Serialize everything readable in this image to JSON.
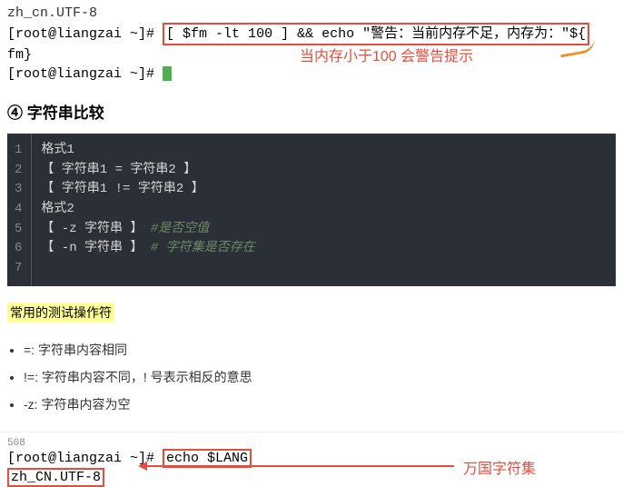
{
  "terminal_top": {
    "line0": "zh_cn.UTF-8",
    "prompt1": "[root@liangzai ~]#",
    "command_boxed": "[ $fm -lt 100 ] && echo \"警告：当前内存不足，内存为：\"${",
    "cont": "fm}",
    "prompt2": "[root@liangzai ~]#",
    "note": "当内存小于100 会警告提示"
  },
  "section4_title": "④ 字符串比较",
  "code": {
    "gutter": [
      "1",
      "2",
      "3",
      "4",
      "5",
      "6",
      "7"
    ],
    "lines": {
      "l1": "格式1",
      "l2": "【 字符串1 = 字符串2 】",
      "l3": "【 字符串1 != 字符串2 】",
      "l4": "",
      "l5": "格式2",
      "l6a": "【 -z 字符串 】",
      "l6c": " #是否空值",
      "l7a": "【 -n 字符串 】",
      "l7c": " # 字符集是否存在"
    }
  },
  "subhead": "常用的测试操作符",
  "bullets": {
    "b1": "=: 字符串内容相同",
    "b2": "!=: 字符串内容不同，! 号表示相反的意思",
    "b3": "-z: 字符串内容为空"
  },
  "terminal_bot": {
    "cut": "508",
    "prompt": "[root@liangzai ~]#",
    "command_boxed": "echo $LANG",
    "output_boxed": "zh_CN.UTF-8",
    "note": "万国字符集"
  }
}
